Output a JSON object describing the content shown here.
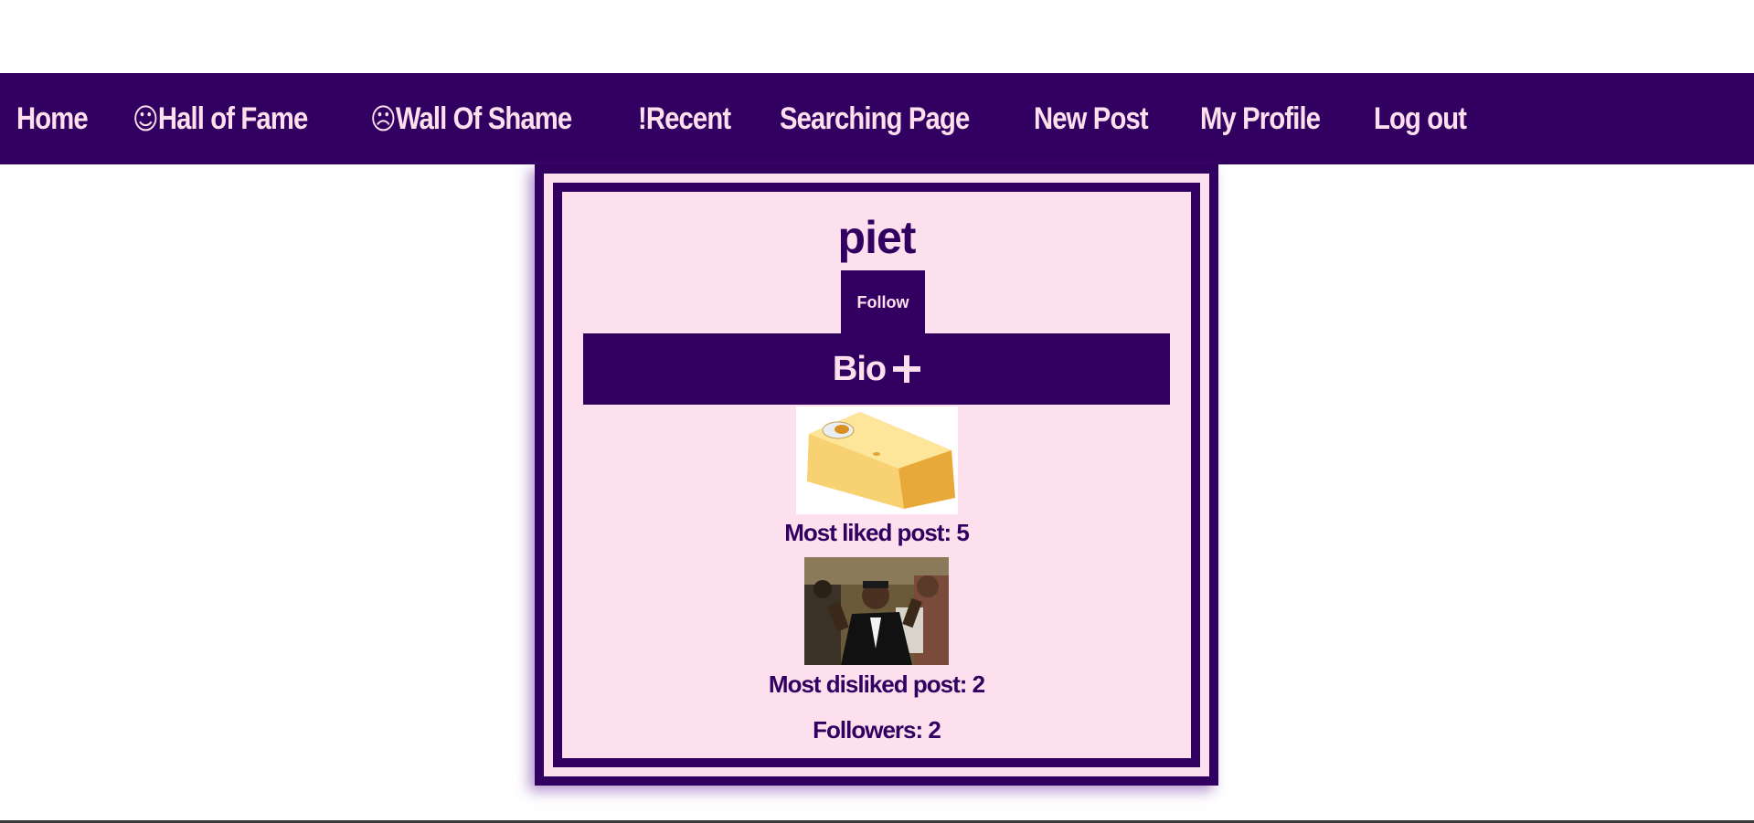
{
  "nav": {
    "items": [
      {
        "label": "Home",
        "glyph": ""
      },
      {
        "label": "Hall of Fame",
        "glyph": "☺"
      },
      {
        "label": "Wall Of Shame",
        "glyph": "☹"
      },
      {
        "label": "!Recent",
        "glyph": ""
      },
      {
        "label": "Searching Page",
        "glyph": ""
      },
      {
        "label": "New Post",
        "glyph": ""
      },
      {
        "label": "My Profile",
        "glyph": ""
      },
      {
        "label": "Log out",
        "glyph": ""
      }
    ]
  },
  "profile": {
    "username": "piet",
    "follow_label": "Follow",
    "bio_label": "Bio",
    "bio_icon": "plus-icon",
    "most_liked": "Most liked post: 5",
    "most_disliked": "Most disliked post: 2",
    "followers": "Followers: 2"
  },
  "colors": {
    "primary": "#310060",
    "background": "#fde0ee"
  }
}
